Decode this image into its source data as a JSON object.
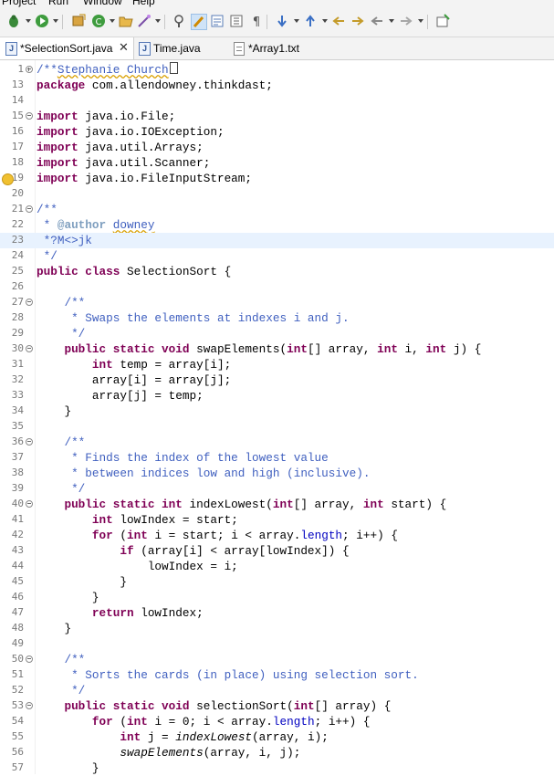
{
  "menu": [
    "Project",
    "Run",
    "Window",
    "Help"
  ],
  "tabs": [
    {
      "label": "*SelectionSort.java",
      "icon": "java-file-icon",
      "active": true
    },
    {
      "label": "Time.java",
      "icon": "java-file-icon",
      "active": false
    },
    {
      "label": "*Array1.txt",
      "icon": "text-file-icon",
      "active": false
    }
  ],
  "editor": {
    "lines": [
      {
        "n": "1",
        "fold": "plus",
        "t": [
          [
            "cm",
            "/**"
          ],
          [
            "cm sq",
            "Stephanie Church"
          ],
          [
            "cur",
            ""
          ]
        ]
      },
      {
        "n": "13",
        "t": [
          [
            "kw",
            "package"
          ],
          [
            "",
            "com.allendowney.thinkdast;"
          ]
        ]
      },
      {
        "n": "14",
        "t": []
      },
      {
        "n": "15",
        "fold": "minus",
        "t": [
          [
            "kw",
            "import"
          ],
          [
            "",
            "java.io.File;"
          ]
        ]
      },
      {
        "n": "16",
        "t": [
          [
            "kw",
            "import"
          ],
          [
            "",
            "java.io.IOException;"
          ]
        ]
      },
      {
        "n": "17",
        "t": [
          [
            "kw",
            "import"
          ],
          [
            "",
            "java.util.Arrays;"
          ]
        ]
      },
      {
        "n": "18",
        "t": [
          [
            "kw",
            "import"
          ],
          [
            "",
            "java.util.Scanner;"
          ]
        ]
      },
      {
        "n": "19",
        "warn": true,
        "t": [
          [
            "kw",
            "import"
          ],
          [
            "",
            "java.io.FileInputStream;"
          ]
        ]
      },
      {
        "n": "20",
        "t": []
      },
      {
        "n": "21",
        "fold": "minus",
        "t": [
          [
            "cm",
            "/**"
          ]
        ]
      },
      {
        "n": "22",
        "t": [
          [
            "cm",
            " * "
          ],
          [
            "tag",
            "@author"
          ],
          [
            "cm",
            " "
          ],
          [
            "cm sq",
            "downey"
          ]
        ]
      },
      {
        "n": "23",
        "hl": true,
        "t": [
          [
            "cm",
            " *?M<>jk"
          ]
        ]
      },
      {
        "n": "24",
        "t": [
          [
            "cm",
            " */"
          ]
        ]
      },
      {
        "n": "25",
        "t": [
          [
            "kw",
            "public class"
          ],
          [
            "",
            " SelectionSort {"
          ]
        ]
      },
      {
        "n": "26",
        "t": []
      },
      {
        "n": "27",
        "fold": "minus",
        "t": [
          [
            "cm",
            "    /**"
          ]
        ]
      },
      {
        "n": "28",
        "t": [
          [
            "cm",
            "     * Swaps the elements at indexes i and j."
          ]
        ]
      },
      {
        "n": "29",
        "t": [
          [
            "cm",
            "     */"
          ]
        ]
      },
      {
        "n": "30",
        "fold": "minus",
        "t": [
          [
            "kw",
            "    public static void"
          ],
          [
            "",
            " swapElements("
          ],
          [
            "kw",
            "int"
          ],
          [
            "",
            "[] array, "
          ],
          [
            "kw",
            "int"
          ],
          [
            "",
            " i, "
          ],
          [
            "kw",
            "int"
          ],
          [
            "",
            " j) {"
          ]
        ]
      },
      {
        "n": "31",
        "t": [
          [
            "kw",
            "        int"
          ],
          [
            "",
            " temp = array[i];"
          ]
        ]
      },
      {
        "n": "32",
        "t": [
          [
            "",
            "        array[i] = array[j];"
          ]
        ]
      },
      {
        "n": "33",
        "t": [
          [
            "",
            "        array[j] = temp;"
          ]
        ]
      },
      {
        "n": "34",
        "t": [
          [
            "",
            "    }"
          ]
        ]
      },
      {
        "n": "35",
        "t": []
      },
      {
        "n": "36",
        "fold": "minus",
        "t": [
          [
            "cm",
            "    /**"
          ]
        ]
      },
      {
        "n": "37",
        "t": [
          [
            "cm",
            "     * Finds the index of the lowest value"
          ]
        ]
      },
      {
        "n": "38",
        "t": [
          [
            "cm",
            "     * between indices low and high (inclusive)."
          ]
        ]
      },
      {
        "n": "39",
        "t": [
          [
            "cm",
            "     */"
          ]
        ]
      },
      {
        "n": "40",
        "fold": "minus",
        "t": [
          [
            "kw",
            "    public static int"
          ],
          [
            "",
            " indexLowest("
          ],
          [
            "kw",
            "int"
          ],
          [
            "",
            "[] array, "
          ],
          [
            "kw",
            "int"
          ],
          [
            "",
            " start) {"
          ]
        ]
      },
      {
        "n": "41",
        "t": [
          [
            "kw",
            "        int"
          ],
          [
            "",
            " lowIndex = start;"
          ]
        ]
      },
      {
        "n": "42",
        "t": [
          [
            "kw",
            "        for"
          ],
          [
            "",
            " ("
          ],
          [
            "kw",
            "int"
          ],
          [
            "",
            " i = start; i < array."
          ],
          [
            "fld",
            "length"
          ],
          [
            "",
            "; i++) {"
          ]
        ]
      },
      {
        "n": "43",
        "t": [
          [
            "kw",
            "            if"
          ],
          [
            "",
            " (array[i] < array[lowIndex]) {"
          ]
        ]
      },
      {
        "n": "44",
        "t": [
          [
            "",
            "                lowIndex = i;"
          ]
        ]
      },
      {
        "n": "45",
        "t": [
          [
            "",
            "            }"
          ]
        ]
      },
      {
        "n": "46",
        "t": [
          [
            "",
            "        }"
          ]
        ]
      },
      {
        "n": "47",
        "t": [
          [
            "kw",
            "        return"
          ],
          [
            "",
            " lowIndex;"
          ]
        ]
      },
      {
        "n": "48",
        "t": [
          [
            "",
            "    }"
          ]
        ]
      },
      {
        "n": "49",
        "t": []
      },
      {
        "n": "50",
        "fold": "minus",
        "t": [
          [
            "cm",
            "    /**"
          ]
        ]
      },
      {
        "n": "51",
        "t": [
          [
            "cm",
            "     * Sorts the cards (in place) using selection sort."
          ]
        ]
      },
      {
        "n": "52",
        "t": [
          [
            "cm",
            "     */"
          ]
        ]
      },
      {
        "n": "53",
        "fold": "minus",
        "t": [
          [
            "kw",
            "    public static void"
          ],
          [
            "",
            " selectionSort("
          ],
          [
            "kw",
            "int"
          ],
          [
            "",
            "[] array) {"
          ]
        ]
      },
      {
        "n": "54",
        "t": [
          [
            "kw",
            "        for"
          ],
          [
            "",
            " ("
          ],
          [
            "kw",
            "int"
          ],
          [
            "",
            " i = 0; i < array."
          ],
          [
            "fld",
            "length"
          ],
          [
            "",
            "; i++) {"
          ]
        ]
      },
      {
        "n": "55",
        "t": [
          [
            "kw",
            "            int"
          ],
          [
            "",
            " j = "
          ],
          [
            "it",
            "indexLowest"
          ],
          [
            "",
            "(array, i);"
          ]
        ]
      },
      {
        "n": "56",
        "t": [
          [
            "it",
            "            swapElements"
          ],
          [
            "",
            "(array, i, j);"
          ]
        ]
      },
      {
        "n": "57",
        "t": [
          [
            "",
            "        }"
          ]
        ]
      }
    ]
  }
}
